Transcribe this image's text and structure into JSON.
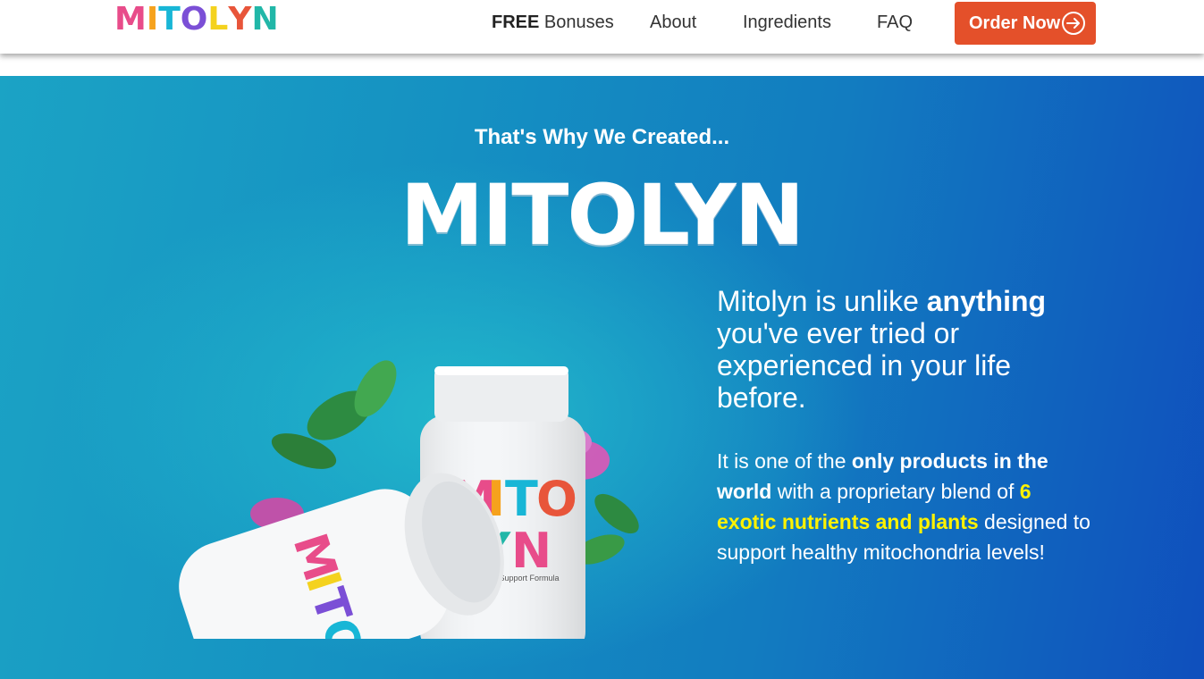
{
  "header": {
    "logo_letters": [
      "M",
      "I",
      "T",
      "O",
      "L",
      "Y",
      "N"
    ],
    "logo_colors": [
      "#e84c8a",
      "#f6a21d",
      "#18b6d6",
      "#7b4fd6",
      "#f4d21e",
      "#e8553a",
      "#21b7a8"
    ],
    "nav": [
      {
        "prefix": "FREE",
        "label": "Bonuses"
      },
      {
        "prefix": "",
        "label": "About"
      },
      {
        "prefix": "",
        "label": "Ingredients"
      },
      {
        "prefix": "",
        "label": "FAQ"
      }
    ],
    "order_label": "Order Now",
    "accent_color": "#e4502a"
  },
  "hero": {
    "kicker": "That's Why We Created...",
    "title": "MITOLYN",
    "lead_before": "Mitolyn is unlike ",
    "lead_bold": "anything",
    "lead_after": " you've ever tried or experienced in your life before.",
    "body_1": "It is one of the ",
    "body_bold": "only products in the world",
    "body_2": " with a proprietary blend of ",
    "body_highlight": "6 exotic nutrients and plants",
    "body_3": " designed to support healthy mitochondria levels!",
    "highlight_color": "#fff200",
    "bottle_label": "Loss Support",
    "bottle_sub": "Formula"
  }
}
